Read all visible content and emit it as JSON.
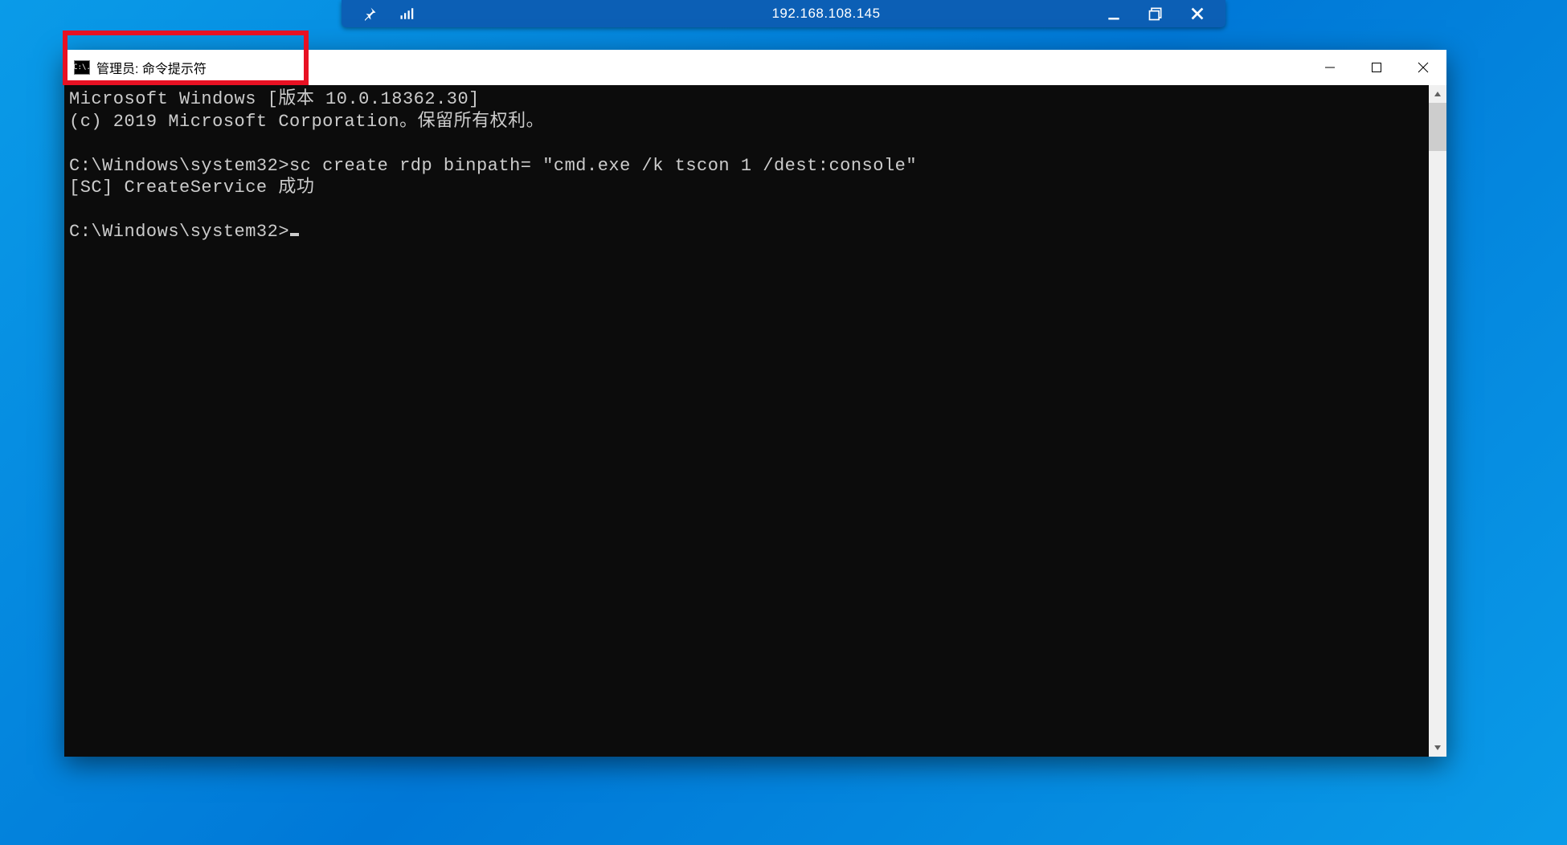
{
  "viewer": {
    "address": "192.168.108.145"
  },
  "cmd": {
    "title": "管理员: 命令提示符",
    "icon_text": "C:\\.",
    "lines": {
      "l1": "Microsoft Windows [版本 10.0.18362.30]",
      "l2": "(c) 2019 Microsoft Corporation。保留所有权利。",
      "l3": "",
      "l4": "C:\\Windows\\system32>sc create rdp binpath= \"cmd.exe /k tscon 1 /dest:console\"",
      "l5": "[SC] CreateService 成功",
      "l6": "",
      "l7": "C:\\Windows\\system32>"
    }
  }
}
